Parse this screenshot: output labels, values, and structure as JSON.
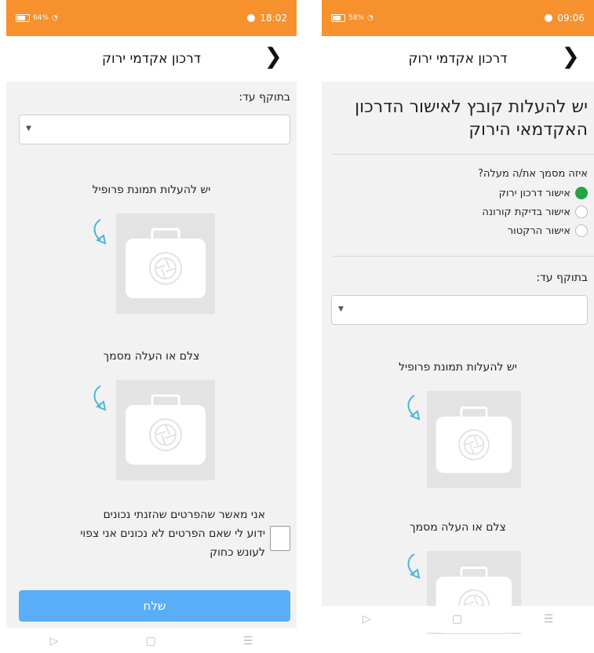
{
  "left_screen": {
    "status": {
      "battery": "64%",
      "time": "18:02"
    },
    "header": {
      "title": "דרכון אקדמי ירוק"
    },
    "valid_until_label": "בתוקף עד:",
    "profile_photo_label": "יש להעלות תמונת פרופיל",
    "document_label": "צלם או העלה מסמך",
    "agreement_text": [
      "אני מאשר שהפרטים שהזנתי נכונים",
      "ידוע לי שאם הפרטים לא נכונים אני צפוי",
      "לעונש כחוק"
    ],
    "send_label": "שלח",
    "nav": {
      "back": "▷",
      "home": "▢",
      "menu": "☰"
    }
  },
  "right_screen": {
    "status": {
      "battery": "58%",
      "time": "09:06"
    },
    "header": {
      "title": "דרכון אקדמי ירוק"
    },
    "heading": "יש להעלות קובץ לאישור הדרכון האקדמאי הירוק",
    "question": "איזה מסמך את/ה מעלה?",
    "options": [
      {
        "label": "אישור דרכון ירוק",
        "selected": true
      },
      {
        "label": "אישור בדיקת קורונה",
        "selected": false
      },
      {
        "label": "אישור הרקטור",
        "selected": false
      }
    ],
    "valid_until_label": "בתוקף עד:",
    "profile_photo_label": "יש להעלות תמונת פרופיל",
    "document_label": "צלם או העלה מסמך",
    "nav": {
      "back": "▷",
      "home": "▢",
      "menu": "☰"
    }
  },
  "colors": {
    "status_bar": "#f6912d",
    "send_button": "#5aaef7",
    "radio_selected": "#25a244"
  }
}
